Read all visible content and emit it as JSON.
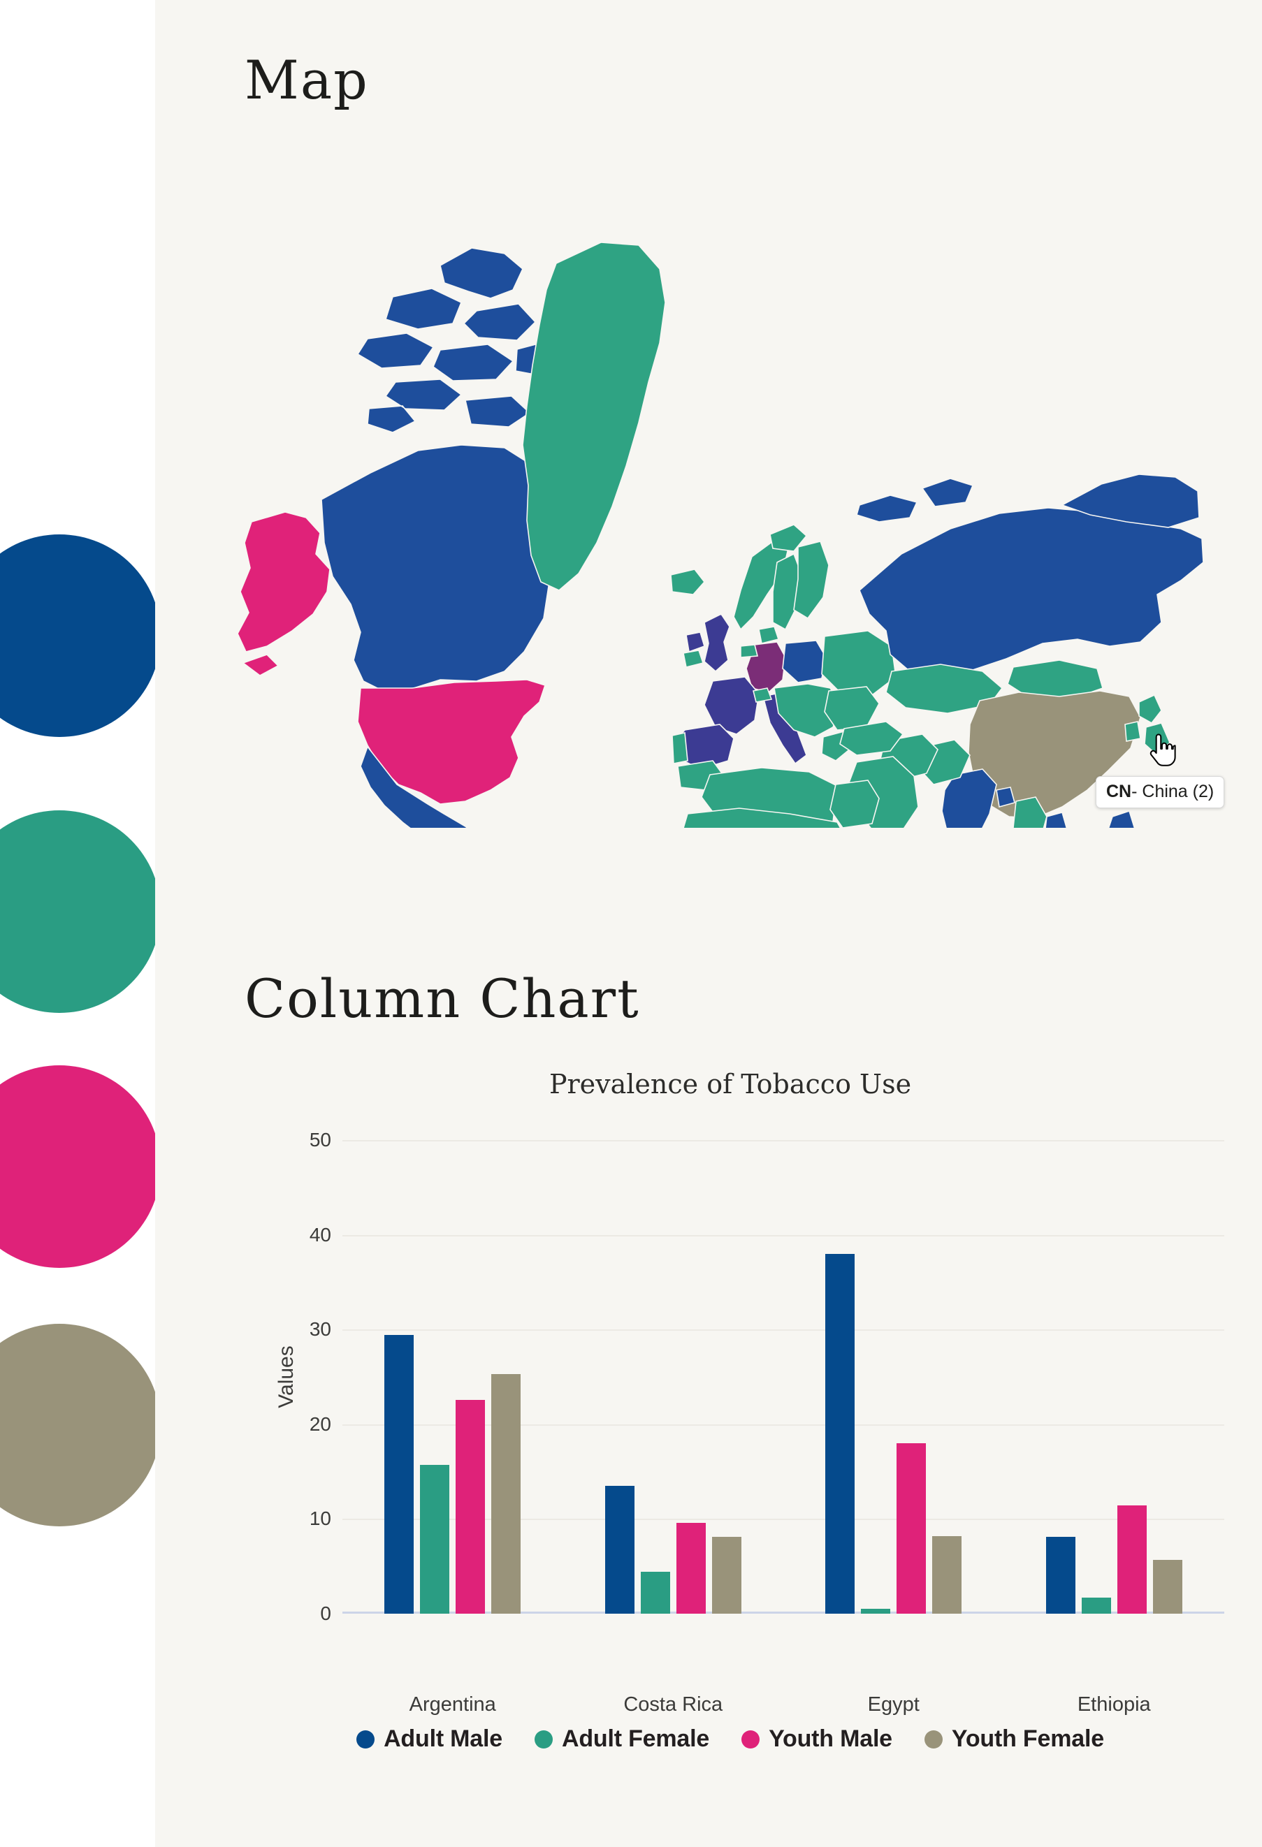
{
  "theme": {
    "page_bg": "#ffffff",
    "panel_bg": "#F7F6F2",
    "text": "#1d1d1b",
    "grid": "#eceae4",
    "axis": "#ccd4e8"
  },
  "palette": {
    "adult_male": "#054A8C",
    "adult_female": "#2A9D83",
    "youth_male": "#DF2279",
    "youth_female": "#99937A"
  },
  "swatches": [
    {
      "name": "adult-male-swatch",
      "color": "#054A8C"
    },
    {
      "name": "adult-female-swatch",
      "color": "#2A9D83"
    },
    {
      "name": "youth-male-swatch",
      "color": "#DF2279"
    },
    {
      "name": "youth-female-swatch",
      "color": "#99937A"
    }
  ],
  "map_section": {
    "title": "Map",
    "tooltip": {
      "code": "CN",
      "separator": "- ",
      "country": "China",
      "value": "(2)",
      "full": "CN- China (2)"
    },
    "cursor": "pointing-hand",
    "map_colors": {
      "blue": "#1E4E9C",
      "dark_blue": "#054A8C",
      "green": "#2FA383",
      "pink": "#E02279",
      "khaki": "#99937A",
      "purple": "#7B2D77",
      "indigo": "#3C3B93",
      "ocean": "#F7F6F2",
      "border": "#F7F6F2"
    },
    "highlighted_countries": {
      "khaki": [
        "China"
      ],
      "pink": [
        "United States",
        "Alaska"
      ],
      "purple": [
        "Germany"
      ],
      "indigo": [
        "United Kingdom",
        "France",
        "Spain",
        "Italy"
      ]
    }
  },
  "chart_section": {
    "title": "Column Chart"
  },
  "chart_data": {
    "type": "bar",
    "title": "Prevalence of Tobacco Use",
    "xlabel": "",
    "ylabel": "Values",
    "ylim": [
      0,
      50
    ],
    "yticks": [
      0,
      10,
      20,
      30,
      40,
      50
    ],
    "grid": true,
    "legend_position": "bottom",
    "categories": [
      "Argentina",
      "Costa Rica",
      "Egypt",
      "Ethiopia"
    ],
    "series": [
      {
        "name": "Adult Male",
        "color": "#054A8C",
        "values": [
          29.4,
          13.5,
          38.0,
          8.1
        ]
      },
      {
        "name": "Adult Female",
        "color": "#2A9D83",
        "values": [
          15.7,
          4.4,
          0.5,
          1.7
        ]
      },
      {
        "name": "Youth Male",
        "color": "#DF2279",
        "values": [
          22.6,
          9.6,
          18.0,
          11.4
        ]
      },
      {
        "name": "Youth Female",
        "color": "#99937A",
        "values": [
          25.3,
          8.1,
          8.2,
          5.7
        ]
      }
    ]
  }
}
